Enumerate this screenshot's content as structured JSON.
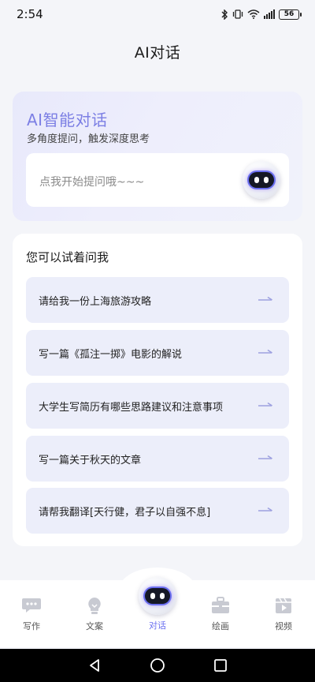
{
  "status_bar": {
    "time": "2:54",
    "battery": "56"
  },
  "header": {
    "title": "AI对话"
  },
  "hero": {
    "title": "AI智能对话",
    "subtitle": "多角度提问，触发深度思考",
    "prompt_placeholder": "点我开始提问哦~~~"
  },
  "suggestions": {
    "title": "您可以试着问我",
    "items": [
      {
        "text": "请给我一份上海旅游攻略"
      },
      {
        "text": "写一篇《孤注一掷》电影的解说"
      },
      {
        "text": "大学生写简历有哪些思路建议和注意事项"
      },
      {
        "text": "写一篇关于秋天的文章"
      },
      {
        "text": "请帮我翻译[天行健，君子以自强不息]"
      }
    ]
  },
  "bottom_nav": {
    "items": [
      {
        "label": "写作",
        "icon": "chat-bubble-icon"
      },
      {
        "label": "文案",
        "icon": "lightbulb-icon"
      },
      {
        "label": "对话",
        "icon": "robot-icon"
      },
      {
        "label": "绘画",
        "icon": "toolbox-icon"
      },
      {
        "label": "视频",
        "icon": "video-icon"
      }
    ],
    "active_color": "#6a6ff0"
  },
  "colors": {
    "accent": "#7c7fe4",
    "item_bg": "#eceefa"
  }
}
